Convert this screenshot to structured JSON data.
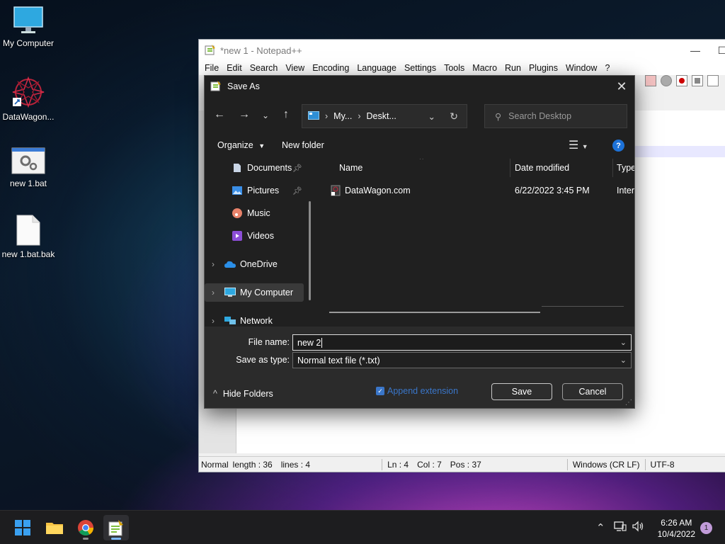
{
  "desktop": {
    "icons": [
      {
        "label": "My Computer"
      },
      {
        "label": "DataWagon..."
      },
      {
        "label": "new 1.bat"
      },
      {
        "label": "new 1.bat.bak"
      }
    ]
  },
  "notepad": {
    "title": "*new 1 - Notepad++",
    "menu": [
      "File",
      "Edit",
      "Search",
      "View",
      "Encoding",
      "Language",
      "Settings",
      "Tools",
      "Macro",
      "Run",
      "Plugins",
      "Window",
      "?"
    ],
    "status": {
      "mode": "Normal",
      "length": "length : 36",
      "lines": "lines : 4",
      "ln": "Ln : 4",
      "col": "Col : 7",
      "pos": "Pos : 37",
      "eol": "Windows (CR LF)",
      "encoding": "UTF-8"
    }
  },
  "dialog": {
    "title": "Save As",
    "close": "✕",
    "address": {
      "seg1": "My...",
      "seg2": "Deskt..."
    },
    "search": {
      "placeholder": "Search Desktop"
    },
    "commands": {
      "organize": "Organize",
      "new_folder": "New folder",
      "help": "?"
    },
    "nav": {
      "items": [
        {
          "label": "Documents"
        },
        {
          "label": "Pictures"
        },
        {
          "label": "Music"
        },
        {
          "label": "Videos"
        },
        {
          "label": "OneDrive"
        },
        {
          "label": "My Computer"
        },
        {
          "label": "Network"
        }
      ]
    },
    "columns": {
      "name": "Name",
      "date": "Date modified",
      "type": "Type"
    },
    "files": [
      {
        "name": "DataWagon.com",
        "date": "6/22/2022 3:45 PM",
        "type": "Intern"
      }
    ],
    "file_name": {
      "label": "File name:",
      "value": "new 2"
    },
    "save_type": {
      "label": "Save as type:",
      "value": "Normal text file (*.txt)"
    },
    "hide_folders": "Hide Folders",
    "append_extension": "Append extension",
    "save": "Save",
    "cancel": "Cancel"
  },
  "taskbar": {
    "time": "6:26 AM",
    "date": "10/4/2022",
    "notifications": "1"
  }
}
